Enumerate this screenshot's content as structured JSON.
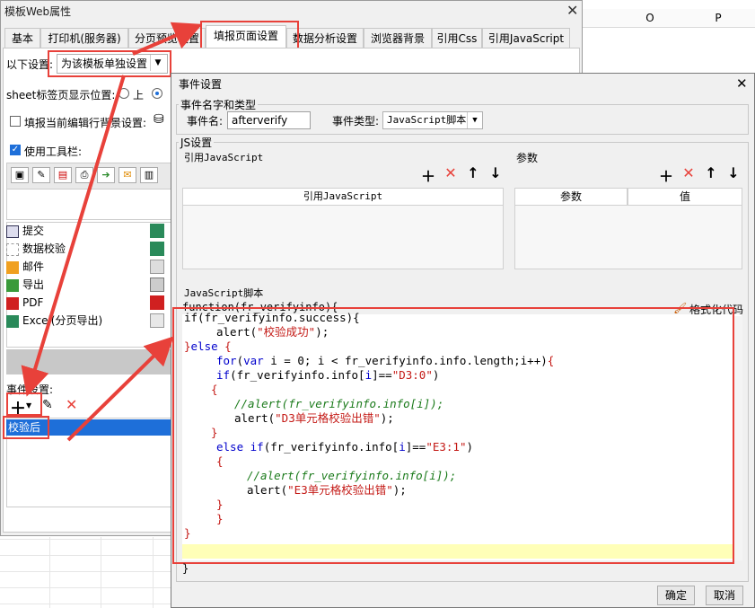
{
  "sheet": {
    "columns": [
      "O",
      "P"
    ]
  },
  "back_dialog": {
    "title": "模板Web属性",
    "close_glyph": "✕",
    "tabs": [
      "基本",
      "打印机(服务器)",
      "分页预览设置",
      "填报页面设置",
      "数据分析设置",
      "浏览器背景",
      "引用Css",
      "引用JavaScript"
    ],
    "active_tab": "填报页面设置",
    "settings_label": "以下设置:",
    "settings_value": "为该模板单独设置",
    "sheet_position_label": "sheet标签页显示位置:",
    "sheet_position_option": "上",
    "highlight_row_label": "填报当前编辑行背景设置:",
    "use_toolbar_label": "使用工具栏:",
    "toolbar_items": [
      {
        "label": "提交",
        "icon": "save-icon"
      },
      {
        "label": "数据校验",
        "icon": "verify-icon"
      },
      {
        "label": "邮件",
        "icon": "mail-icon"
      },
      {
        "label": "导出",
        "icon": "export-icon"
      },
      {
        "label": "PDF",
        "icon": "pdf-icon"
      },
      {
        "label": "Excel(分页导出)",
        "icon": "excel-icon"
      }
    ],
    "events_label": "事件设置:",
    "event_items": [
      "校验后"
    ]
  },
  "front_dialog": {
    "title": "事件设置",
    "close_glyph": "✕",
    "name_type_group": "事件名字和类型",
    "event_name_label": "事件名:",
    "event_name_value": "afterverify",
    "event_type_label": "事件类型:",
    "event_type_value": "JavaScript脚本",
    "js_group": "JS设置",
    "ref_js_label": "引用JavaScript",
    "params_label": "参数",
    "ref_js_col": "引用JavaScript",
    "param_col": "参数",
    "value_col": "值",
    "script_label": "JavaScript脚本",
    "format_label": "格式化代码",
    "function_header": "function(fr_verifyinfo){",
    "code_top_partial": "if(fr_verifyinfo.success){",
    "code_close": "}",
    "ok_label": "确定",
    "cancel_label": "取消"
  },
  "colors": {
    "annotation_red": "#e8413a",
    "selection_blue": "#1e6fd9"
  }
}
